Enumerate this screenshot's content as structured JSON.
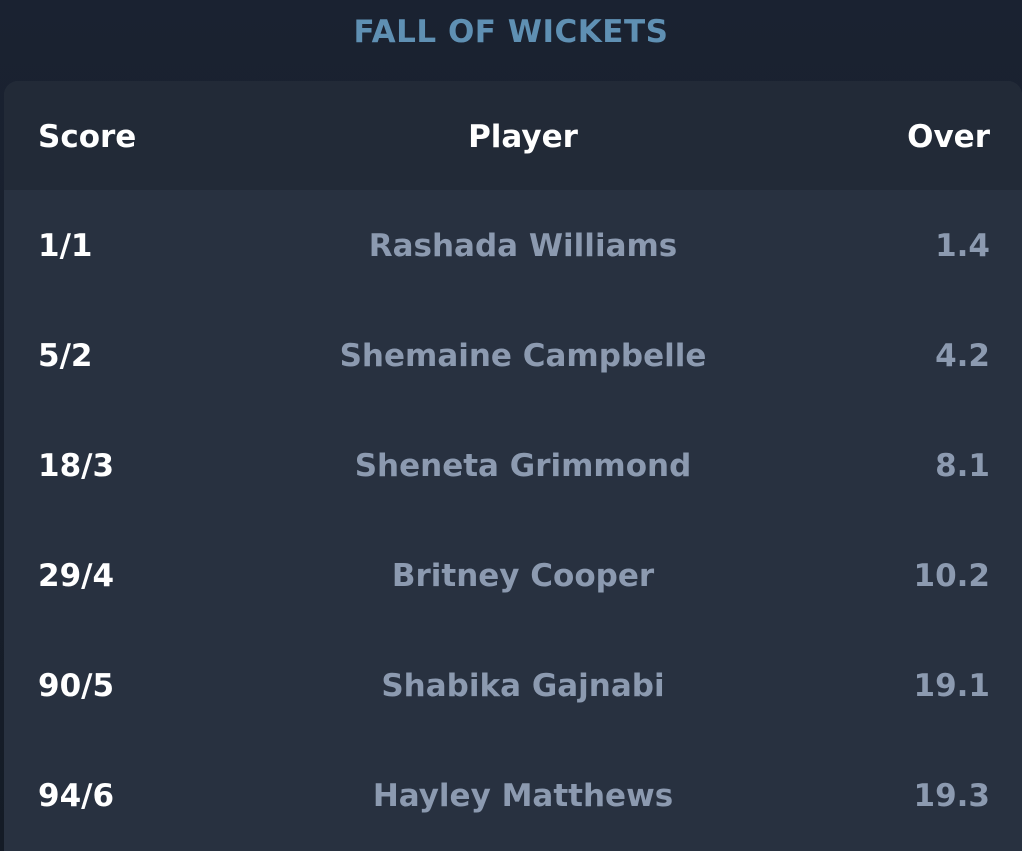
{
  "title": "FALL OF WICKETS",
  "columns": {
    "score": "Score",
    "player": "Player",
    "over": "Over"
  },
  "rows": [
    {
      "score": "1/1",
      "player": "Rashada Williams",
      "over": "1.4"
    },
    {
      "score": "5/2",
      "player": "Shemaine Campbelle",
      "over": "4.2"
    },
    {
      "score": "18/3",
      "player": "Sheneta Grimmond",
      "over": "8.1"
    },
    {
      "score": "29/4",
      "player": "Britney Cooper",
      "over": "10.2"
    },
    {
      "score": "90/5",
      "player": "Shabika Gajnabi",
      "over": "19.1"
    },
    {
      "score": "94/6",
      "player": "Hayley Matthews",
      "over": "19.3"
    }
  ],
  "colors": {
    "background": "#1a2231",
    "card": "#283140",
    "header_row": "#222a37",
    "title": "#5f90b3",
    "muted_text": "#8c9ab0",
    "primary_text": "#ffffff"
  }
}
